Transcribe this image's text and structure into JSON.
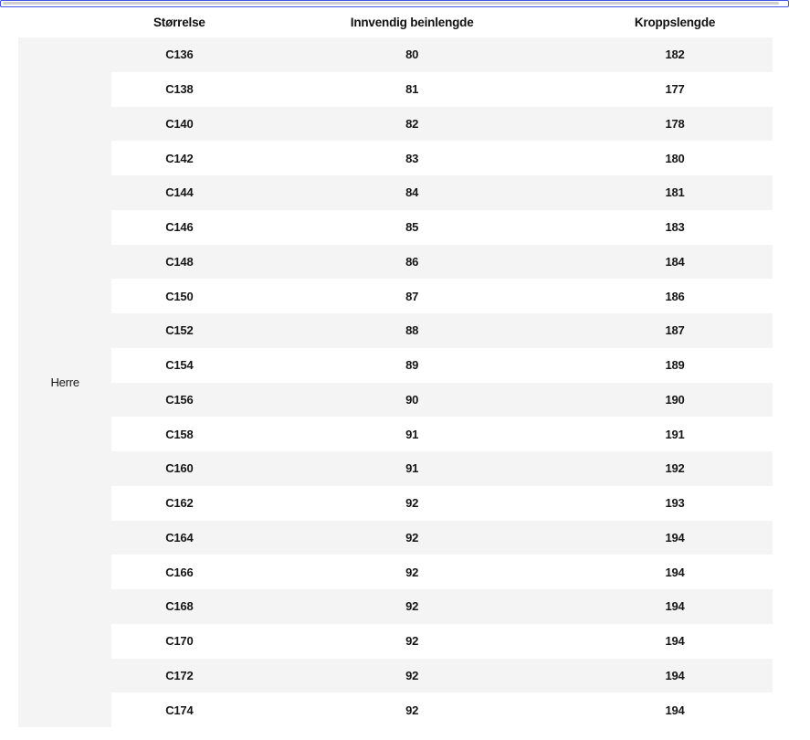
{
  "scrollbar": {
    "border_color": "#4453e8",
    "thumb_color": "#cdcdd2"
  },
  "colors": {
    "stripe": "#f4f4f5",
    "background": "#ffffff",
    "text": "#141414"
  },
  "table": {
    "group_label": "Herre",
    "columns": [
      "Størrelse",
      "Innvendig beinlengde",
      "Kroppslengde"
    ],
    "rows": [
      {
        "size": "C136",
        "inner_leg": "80",
        "body_length": "182"
      },
      {
        "size": "C138",
        "inner_leg": "81",
        "body_length": "177"
      },
      {
        "size": "C140",
        "inner_leg": "82",
        "body_length": "178"
      },
      {
        "size": "C142",
        "inner_leg": "83",
        "body_length": "180"
      },
      {
        "size": "C144",
        "inner_leg": "84",
        "body_length": "181"
      },
      {
        "size": "C146",
        "inner_leg": "85",
        "body_length": "183"
      },
      {
        "size": "C148",
        "inner_leg": "86",
        "body_length": "184"
      },
      {
        "size": "C150",
        "inner_leg": "87",
        "body_length": "186"
      },
      {
        "size": "C152",
        "inner_leg": "88",
        "body_length": "187"
      },
      {
        "size": "C154",
        "inner_leg": "89",
        "body_length": "189"
      },
      {
        "size": "C156",
        "inner_leg": "90",
        "body_length": "190"
      },
      {
        "size": "C158",
        "inner_leg": "91",
        "body_length": "191"
      },
      {
        "size": "C160",
        "inner_leg": "91",
        "body_length": "192"
      },
      {
        "size": "C162",
        "inner_leg": "92",
        "body_length": "193"
      },
      {
        "size": "C164",
        "inner_leg": "92",
        "body_length": "194"
      },
      {
        "size": "C166",
        "inner_leg": "92",
        "body_length": "194"
      },
      {
        "size": "C168",
        "inner_leg": "92",
        "body_length": "194"
      },
      {
        "size": "C170",
        "inner_leg": "92",
        "body_length": "194"
      },
      {
        "size": "C172",
        "inner_leg": "92",
        "body_length": "194"
      },
      {
        "size": "C174",
        "inner_leg": "92",
        "body_length": "194"
      }
    ]
  }
}
